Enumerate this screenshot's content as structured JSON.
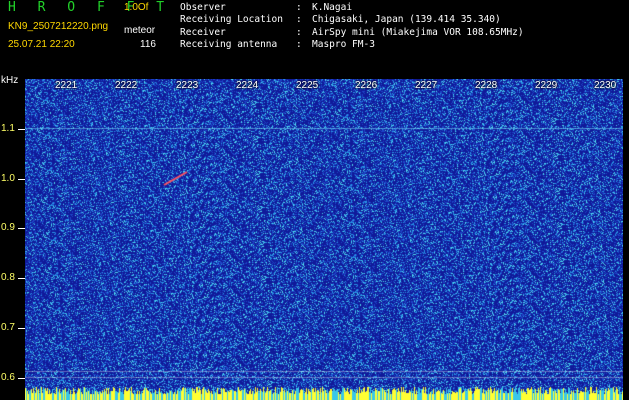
{
  "header": {
    "app_title": "H R O F F T",
    "mode": "1.0Of",
    "filename": "KN9_2507212220.png",
    "count_type": "meteor",
    "datetime": "25.07.21 22:20",
    "count_value": "116"
  },
  "info": [
    {
      "key": "Observer",
      "sep": ":",
      "value": "K.Nagai"
    },
    {
      "key": "Receiving Location",
      "sep": ":",
      "value": "Chigasaki, Japan (139.414 35.340)"
    },
    {
      "key": "Receiver",
      "sep": ":",
      "value": "AirSpy mini (Miakejima VOR 108.65MHz)"
    },
    {
      "key": "Receiving antenna",
      "sep": ":",
      "value": "Maspro FM-3"
    }
  ],
  "spectrogram": {
    "freq_unit": "kHz",
    "y_labels": [
      "1.1",
      "1.0",
      "0.9",
      "0.8",
      "0.7",
      "0.6"
    ],
    "x_labels": [
      "2221",
      "2222",
      "2223",
      "2224",
      "2225",
      "2226",
      "2227",
      "2228",
      "2229",
      "2230"
    ],
    "colors": {
      "background": "#101a9a",
      "noise": "#38c7e8",
      "hot": "#ffff33",
      "meteor": "#ff5060"
    }
  }
}
